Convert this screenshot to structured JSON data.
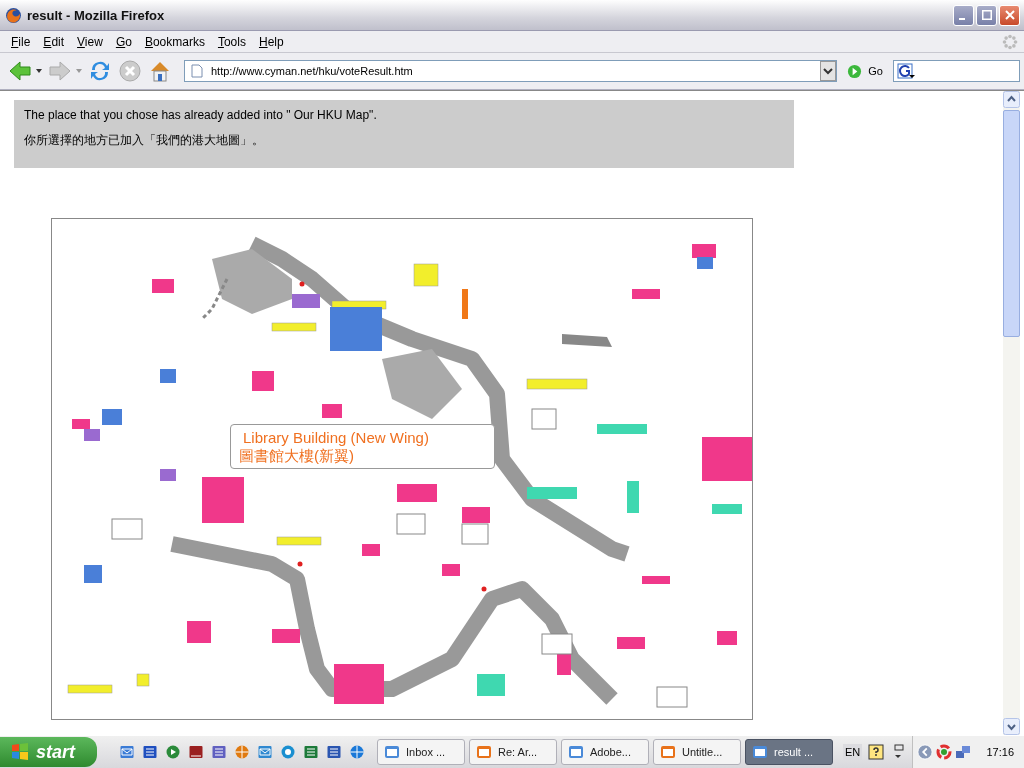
{
  "window": {
    "title": "result - Mozilla Firefox"
  },
  "menu": [
    "File",
    "Edit",
    "View",
    "Go",
    "Bookmarks",
    "Tools",
    "Help"
  ],
  "address": {
    "url": "http://www.cyman.net/hku/voteResult.htm",
    "go": "Go"
  },
  "messages": [
    "The place that you chose has already added into \" Our HKU Map\".",
    "你所選擇的地方已加入「我們的港大地圖」。"
  ],
  "map": {
    "label": [
      "Library Building (New Wing)",
      "圖書館大樓(新翼)"
    ]
  },
  "taskbar": {
    "start": "start",
    "tasks": [
      {
        "label": "Inbox ...",
        "selected": false
      },
      {
        "label": "Re: Ar...",
        "selected": false
      },
      {
        "label": "Adobe...",
        "selected": false
      },
      {
        "label": "Untitle...",
        "selected": false
      },
      {
        "label": "result ...",
        "selected": true
      }
    ],
    "language": "EN",
    "clock": "17:16"
  }
}
